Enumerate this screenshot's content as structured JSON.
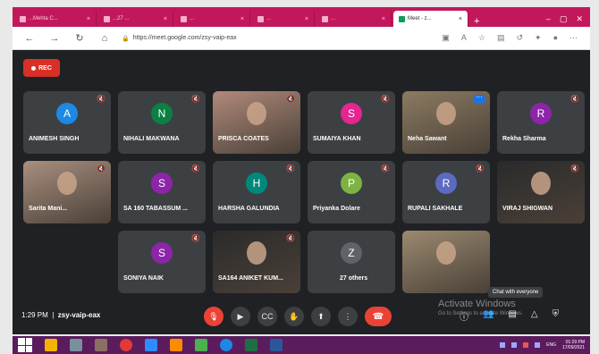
{
  "browser": {
    "tabs": [
      {
        "label": "...Mehta C...",
        "active": false
      },
      {
        "label": "...27 ...",
        "active": false
      },
      {
        "label": "...",
        "active": false
      },
      {
        "label": "...",
        "active": false
      },
      {
        "label": "...",
        "active": false
      },
      {
        "label": "Meet - z...",
        "active": true
      }
    ],
    "new_tab": "+",
    "url": "https://meet.google.com/zsy-vaip-eax"
  },
  "meet": {
    "rec_label": "REC",
    "tiles": [
      {
        "name": "ANIMESH SINGH",
        "initial": "A",
        "color": "#1e88e5",
        "kind": "avatar"
      },
      {
        "name": "NIHALI MAKWANA",
        "initial": "N",
        "color": "#0b8043",
        "kind": "avatar"
      },
      {
        "name": "PRISCA COATES",
        "initial": "",
        "color": "#b08a7a",
        "kind": "photo"
      },
      {
        "name": "SUMAIYA KHAN",
        "initial": "S",
        "color": "#e52592",
        "kind": "avatar"
      },
      {
        "name": "Neha Sawant",
        "initial": "",
        "color": "#8c7b62",
        "kind": "photo"
      },
      {
        "name": "Rekha Sharma",
        "initial": "R",
        "color": "#8e24aa",
        "kind": "avatar"
      },
      {
        "name": "Sarita Mani...",
        "initial": "",
        "color": "#a98f7f",
        "kind": "photo"
      },
      {
        "name": "SA 160 TABASSUM ...",
        "initial": "S",
        "color": "#8e24aa",
        "kind": "avatar"
      },
      {
        "name": "HARSHA GALUNDIA",
        "initial": "H",
        "color": "#00897b",
        "kind": "avatar"
      },
      {
        "name": "Priyanka Dolare",
        "initial": "P",
        "color": "#7cb342",
        "kind": "avatar"
      },
      {
        "name": "RUPALI SAKHALE",
        "initial": "R",
        "color": "#5c6bc0",
        "kind": "avatar"
      },
      {
        "name": "VIRAJ SHIGWAN",
        "initial": "",
        "color": "#2a2a2a",
        "kind": "photo"
      },
      {
        "name": "SONIYA NAIK",
        "initial": "S",
        "color": "#8e24aa",
        "kind": "avatar"
      },
      {
        "name": "SA164 ANIKET KUM...",
        "initial": "",
        "color": "#2b2b2b",
        "kind": "photo"
      },
      {
        "name": "27 others",
        "initial": "Z",
        "color": "#5f6368",
        "kind": "others"
      },
      {
        "name": "",
        "initial": "",
        "color": "#9b8a70",
        "kind": "photo"
      }
    ],
    "clock": "1:29 PM",
    "meeting_code": "zsy-vaip-eax",
    "tooltip": "Chat with everyone",
    "watermark_title": "Activate Windows",
    "watermark_sub": "Go to Settings to activate Windows."
  },
  "taskbar": {
    "time": "01:29 PM",
    "date": "17/09/2021",
    "lang": "ENG"
  },
  "colors": {
    "tab_strip": "#c2185b",
    "meet_bg": "#202124",
    "tile_bg": "#3c4043",
    "danger": "#ea4335",
    "taskbar": "#5b1c5e"
  }
}
